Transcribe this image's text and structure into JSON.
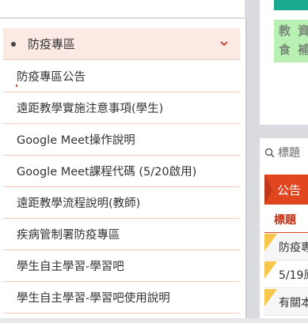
{
  "menu": {
    "header_label": "防疫專區",
    "items": [
      "防疫專區公告",
      "遠距教學實施注意事項(學生)",
      "Google Meet操作說明",
      "Google Meet課程代碼 (5/20啟用)",
      "遠距教學流程說明(教師)",
      "疾病管制署防疫專區",
      "學生自主學習-學習吧",
      "學生自主學習-學習吧使用說明"
    ]
  },
  "right_top": {
    "banner_chars": [
      "教",
      "資",
      "食",
      "補"
    ]
  },
  "right_panel": {
    "search_placeholder": "標題",
    "announce_label": "公告",
    "column_header": "標題",
    "rows": [
      "防疫專",
      "5/19原",
      "有關本"
    ]
  },
  "colors": {
    "accent": "#e2461f",
    "menu_header_bg": "#fbeae3",
    "banner_green": "#b9f1b5",
    "teal": "#1aa88e",
    "flag_yellow": "#f7c64d"
  }
}
